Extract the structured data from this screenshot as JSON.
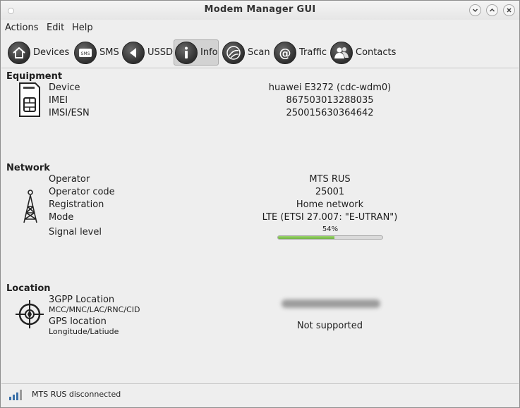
{
  "window": {
    "title": "Modem Manager GUI"
  },
  "menubar": [
    "Actions",
    "Edit",
    "Help"
  ],
  "toolbar": [
    {
      "label": "Devices",
      "icon": "home-icon"
    },
    {
      "label": "SMS",
      "icon": "sms-icon"
    },
    {
      "label": "USSD",
      "icon": "ussd-icon"
    },
    {
      "label": "Info",
      "icon": "info-icon",
      "active": true
    },
    {
      "label": "Scan",
      "icon": "scan-icon"
    },
    {
      "label": "Traffic",
      "icon": "traffic-icon"
    },
    {
      "label": "Contacts",
      "icon": "contacts-icon"
    }
  ],
  "equipment": {
    "title": "Equipment",
    "rows": [
      {
        "label": "Device",
        "value": "huawei E3272 (cdc-wdm0)"
      },
      {
        "label": "IMEI",
        "value": "867503013288035"
      },
      {
        "label": "IMSI/ESN",
        "value": "250015630364642"
      }
    ]
  },
  "network": {
    "title": "Network",
    "rows": [
      {
        "label": "Operator",
        "value": "MTS RUS"
      },
      {
        "label": "Operator code",
        "value": "25001"
      },
      {
        "label": "Registration",
        "value": "Home network"
      },
      {
        "label": "Mode",
        "value": "LTE (ETSI 27.007: \"E-UTRAN\")"
      }
    ],
    "signal_label": "Signal level",
    "signal_text": "54%",
    "signal_level": 0.54
  },
  "location": {
    "title": "Location",
    "gpp_label": "3GPP Location",
    "gpp_sub": "MCC/MNC/LAC/RNC/CID",
    "gps_label": "GPS location",
    "gps_sub": "Longitude/Latiude",
    "gps_value": "Not supported"
  },
  "status": {
    "text": "MTS RUS disconnected"
  }
}
